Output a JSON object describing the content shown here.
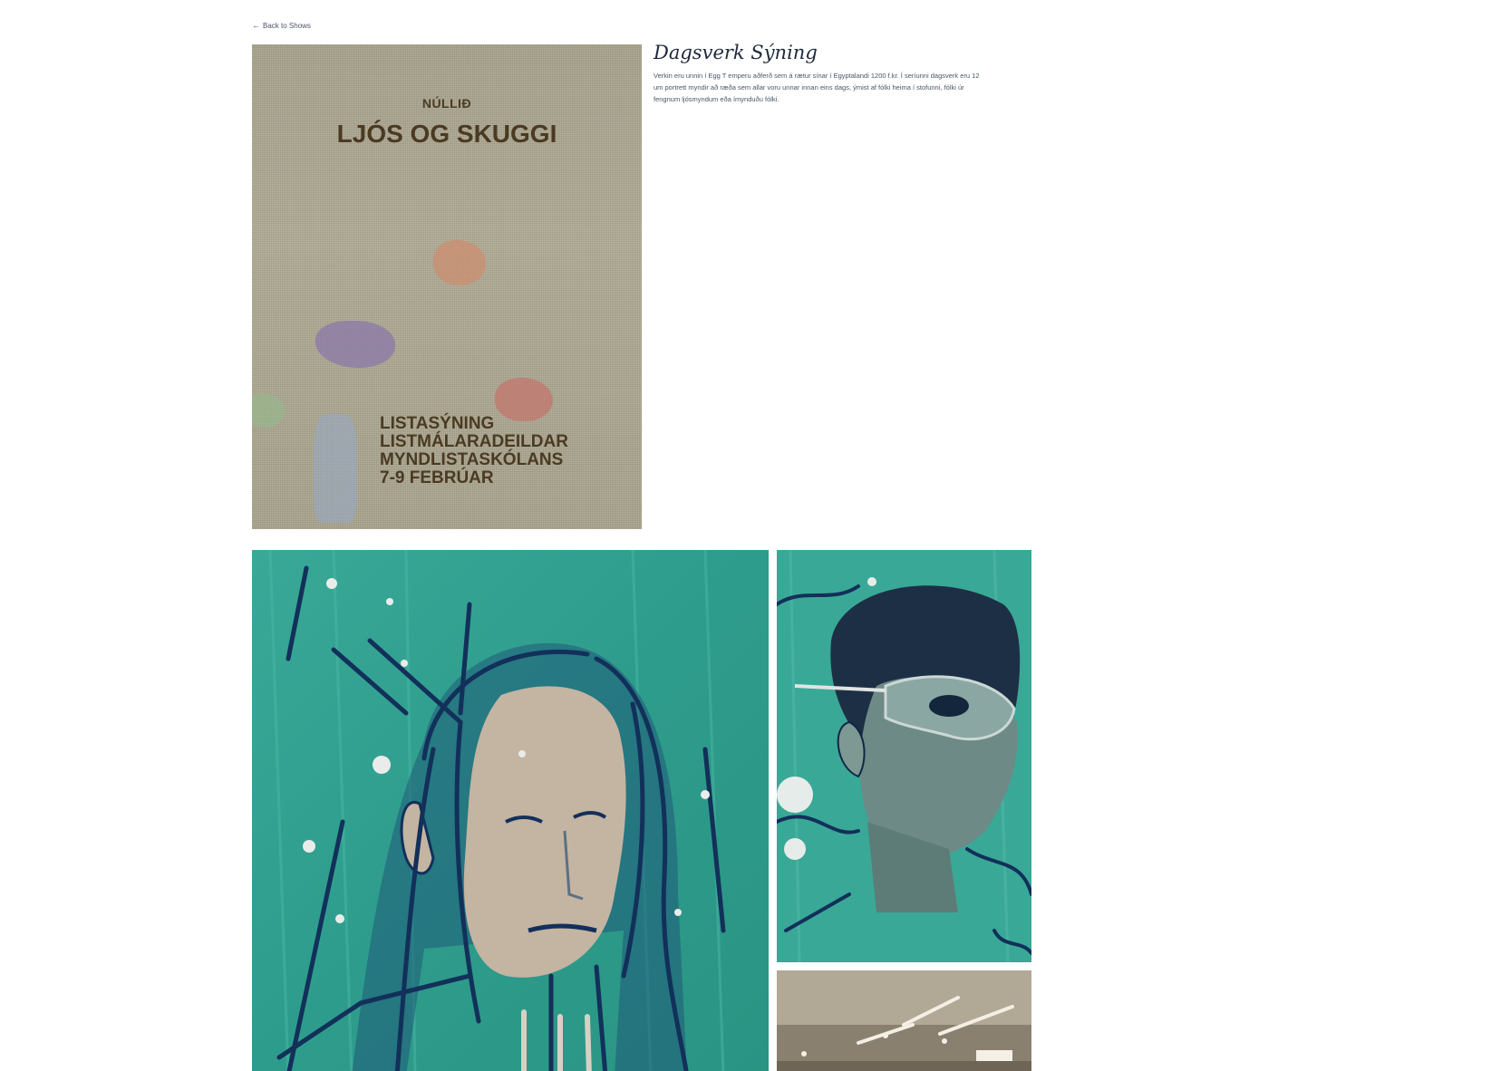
{
  "nav": {
    "back_arrow": "←",
    "back_label": "Back to Shows"
  },
  "show": {
    "title": "Dagsverk Sýning",
    "description": "Verkin eru unnin í Egg T emperu aðferð sem á rætur sínar í Egyptalandi 1200 f.kr. Í seríunni dagsverk eru 12 um portrett myndir að ræða sem allar voru unnar innan eins dags, ýmist af fólki heima í stofunni, fólki úr fengnum ljósmyndum eða ímynduðu fólki."
  },
  "poster": {
    "org": "NÚLLIÐ",
    "title": "LJÓS OG SKUGGI",
    "info_lines": [
      "LISTASÝNING",
      "LISTMÁLARADEILDAR",
      "MYNDLISTASKÓLANS",
      "7-9 FEBRÚAR"
    ],
    "text_color": "#4b3a22",
    "canvas_color": "#aaa58e"
  },
  "paintings": {
    "palette": {
      "teal": "#2f9f8f",
      "teal_light": "#48b0a0",
      "navy": "#12305a",
      "skin": "#c6b3a0"
    },
    "items": [
      {
        "subject": "portrait-long-hair"
      },
      {
        "subject": "portrait-masked-profile"
      },
      {
        "subject": "gallery-interior"
      }
    ]
  }
}
